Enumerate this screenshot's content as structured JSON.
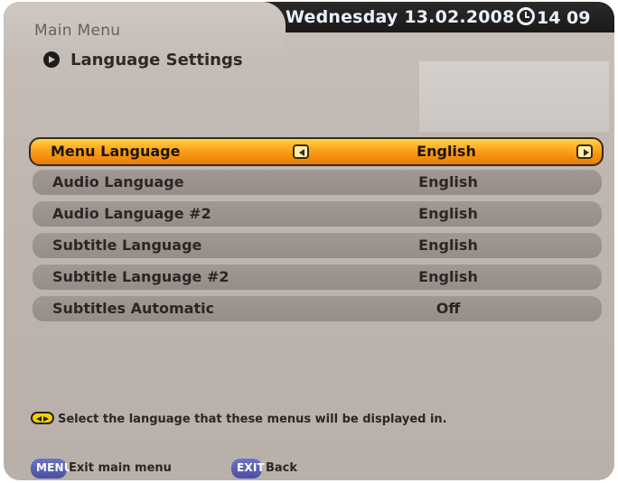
{
  "header": {
    "title": "Main Menu",
    "date": "Wednesday 13.02.2008",
    "time": "14 09",
    "clock_icon": "clock-icon"
  },
  "section": {
    "title": "Language Settings",
    "icon": "arrow-circle-icon"
  },
  "settings": [
    {
      "label": "Menu Language",
      "value": "English",
      "selected": true
    },
    {
      "label": "Audio Language",
      "value": "English",
      "selected": false
    },
    {
      "label": "Audio Language #2",
      "value": "English",
      "selected": false
    },
    {
      "label": "Subtitle Language",
      "value": "English",
      "selected": false
    },
    {
      "label": "Subtitle Language #2",
      "value": "English",
      "selected": false
    },
    {
      "label": "Subtitles Automatic",
      "value": "Off",
      "selected": false
    }
  ],
  "help": {
    "text": "Select the language that these menus will be displayed in.",
    "icon": "left-right-arrows-icon"
  },
  "footer": {
    "menu_key": "MENU",
    "menu_label": "Exit main menu",
    "exit_key": "EXIT",
    "exit_label": "Back"
  },
  "colors": {
    "selected_row_top": "#ffd44a",
    "selected_row_bottom": "#e97a06",
    "row": "#9a928d",
    "key_blue": "#5a60b5"
  }
}
